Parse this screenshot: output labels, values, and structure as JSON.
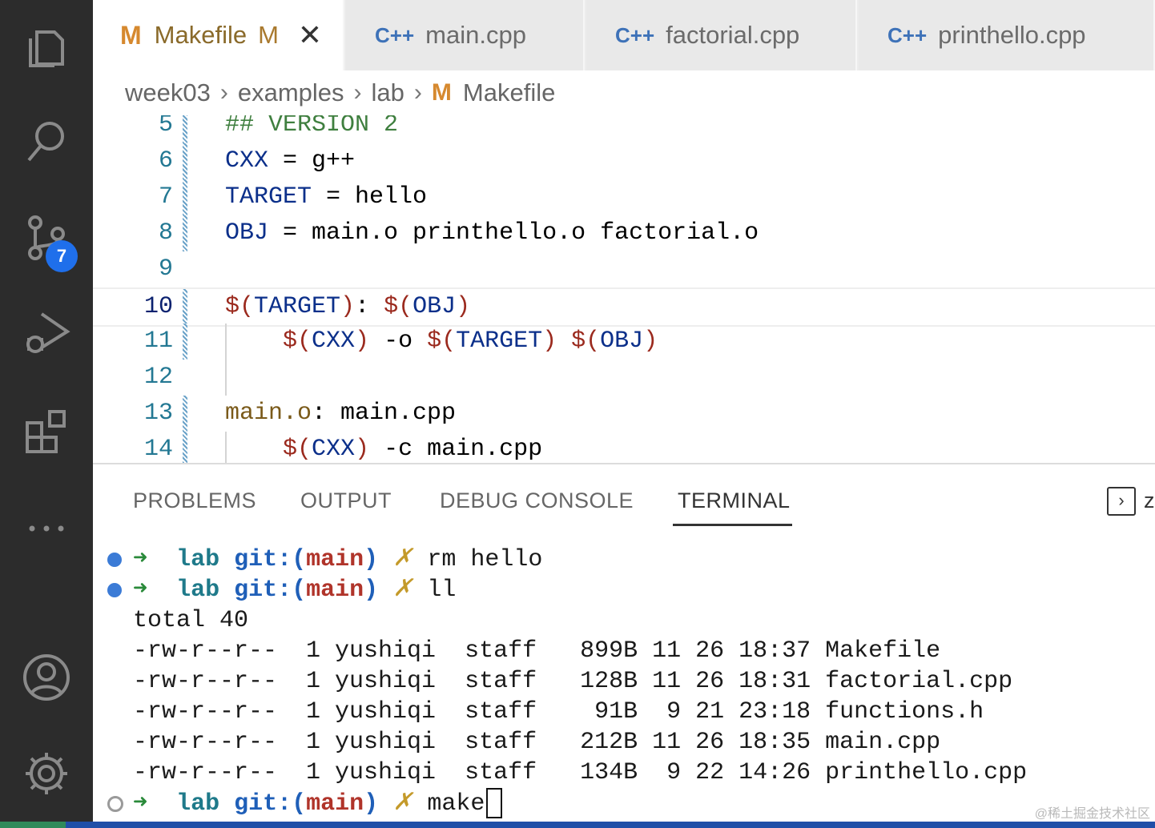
{
  "tabs": [
    {
      "icon": "M",
      "label": "Makefile",
      "badge": "M",
      "close": "✕"
    },
    {
      "icon": "C++",
      "label": "main.cpp"
    },
    {
      "icon": "C++",
      "label": "factorial.cpp"
    },
    {
      "icon": "C++",
      "label": "printhello.cpp"
    }
  ],
  "breadcrumb": [
    "week03",
    "examples",
    "lab",
    "Makefile"
  ],
  "activity_bar": {
    "source_control_badge": "7"
  },
  "editor": {
    "lines": [
      {
        "n": "5",
        "parts": [
          {
            "t": "## VERSION 2",
            "c": "c-comment"
          }
        ]
      },
      {
        "n": "6",
        "parts": [
          {
            "t": "CXX",
            "c": "c-var"
          },
          {
            "t": " = g++",
            "c": ""
          }
        ]
      },
      {
        "n": "7",
        "parts": [
          {
            "t": "TARGET",
            "c": "c-var"
          },
          {
            "t": " = hello",
            "c": ""
          }
        ]
      },
      {
        "n": "8",
        "parts": [
          {
            "t": "OBJ",
            "c": "c-var"
          },
          {
            "t": " = main.o printhello.o factorial.o",
            "c": ""
          }
        ]
      },
      {
        "n": "9",
        "parts": []
      },
      {
        "n": "10",
        "parts": [
          {
            "t": "$(",
            "c": "c-sym"
          },
          {
            "t": "TARGET",
            "c": "c-var"
          },
          {
            "t": ")",
            "c": "c-sym"
          },
          {
            "t": ": ",
            "c": ""
          },
          {
            "t": "$(",
            "c": "c-sym"
          },
          {
            "t": "OBJ",
            "c": "c-var"
          },
          {
            "t": ")",
            "c": "c-sym"
          }
        ]
      },
      {
        "n": "11",
        "parts": [
          {
            "t": "    ",
            "c": ""
          },
          {
            "t": "$(",
            "c": "c-sym"
          },
          {
            "t": "CXX",
            "c": "c-var"
          },
          {
            "t": ")",
            "c": "c-sym"
          },
          {
            "t": " -o ",
            "c": ""
          },
          {
            "t": "$(",
            "c": "c-sym"
          },
          {
            "t": "TARGET",
            "c": "c-var"
          },
          {
            "t": ")",
            "c": "c-sym"
          },
          {
            "t": " ",
            "c": ""
          },
          {
            "t": "$(",
            "c": "c-sym"
          },
          {
            "t": "OBJ",
            "c": "c-var"
          },
          {
            "t": ")",
            "c": "c-sym"
          }
        ]
      },
      {
        "n": "12",
        "parts": []
      },
      {
        "n": "13",
        "parts": [
          {
            "t": "main.o",
            "c": "c-target"
          },
          {
            "t": ": main.cpp",
            "c": ""
          }
        ]
      },
      {
        "n": "14",
        "parts": [
          {
            "t": "    ",
            "c": ""
          },
          {
            "t": "$(",
            "c": "c-sym"
          },
          {
            "t": "CXX",
            "c": "c-var"
          },
          {
            "t": ")",
            "c": "c-sym"
          },
          {
            "t": " -c main.cpp",
            "c": ""
          }
        ]
      }
    ]
  },
  "panel": {
    "tabs": [
      "PROBLEMS",
      "OUTPUT",
      "DEBUG CONSOLE",
      "TERMINAL"
    ],
    "active": "TERMINAL",
    "extra": "z"
  },
  "terminal": {
    "prompt": {
      "arrow": "➜",
      "dir": "lab",
      "git": "git:(",
      "branch": "main",
      "git_close": ")",
      "dirty": "✗"
    },
    "commands": [
      "rm hello",
      "ll",
      "make"
    ],
    "total": "total 40",
    "files": [
      {
        "perm": "-rw-r--r--",
        "links": "1",
        "owner": "yushiqi",
        "group": "staff",
        "size": "899B",
        "month": "11",
        "day": "26",
        "time": "18:37",
        "name": "Makefile"
      },
      {
        "perm": "-rw-r--r--",
        "links": "1",
        "owner": "yushiqi",
        "group": "staff",
        "size": "128B",
        "month": "11",
        "day": "26",
        "time": "18:31",
        "name": "factorial.cpp"
      },
      {
        "perm": "-rw-r--r--",
        "links": "1",
        "owner": "yushiqi",
        "group": "staff",
        "size": "91B",
        "month": "9",
        "day": "21",
        "time": "23:18",
        "name": "functions.h"
      },
      {
        "perm": "-rw-r--r--",
        "links": "1",
        "owner": "yushiqi",
        "group": "staff",
        "size": "212B",
        "month": "11",
        "day": "26",
        "time": "18:35",
        "name": "main.cpp"
      },
      {
        "perm": "-rw-r--r--",
        "links": "1",
        "owner": "yushiqi",
        "group": "staff",
        "size": "134B",
        "month": "9",
        "day": "22",
        "time": "14:26",
        "name": "printhello.cpp"
      }
    ]
  },
  "watermark": "@稀土掘金技术社区"
}
